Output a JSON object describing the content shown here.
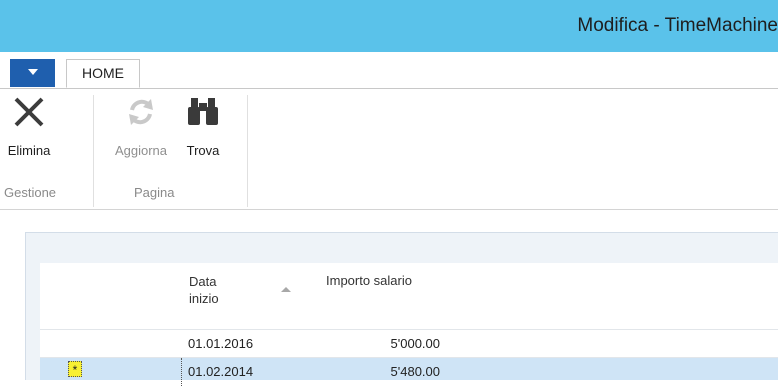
{
  "window": {
    "title": "Modifica - TimeMachine"
  },
  "ribbon": {
    "app_button_icon": "dropdown-triangle-icon",
    "tabs": [
      {
        "label": "HOME",
        "active": true
      }
    ],
    "groups": [
      {
        "label": "Gestione",
        "buttons": [
          {
            "label": "Elimina",
            "icon": "delete-x-icon",
            "enabled": true
          }
        ]
      },
      {
        "label": "Pagina",
        "buttons": [
          {
            "label": "Aggiorna",
            "icon": "refresh-icon",
            "enabled": false
          },
          {
            "label": "Trova",
            "icon": "binoculars-icon",
            "enabled": true
          }
        ]
      }
    ]
  },
  "grid": {
    "columns": [
      {
        "label": "Data\ninizio",
        "sorted": "ascending"
      },
      {
        "label": "Importo salario"
      }
    ],
    "rows": [
      {
        "marker": "",
        "data_inizio": "01.01.2016",
        "importo": "5'000.00",
        "selected": false
      },
      {
        "marker": "*",
        "data_inizio": "01.02.2014",
        "importo": "5'480.00",
        "selected": true
      }
    ]
  },
  "colors": {
    "titlebar": "#5ac2ea",
    "app_button": "#1f5fae",
    "selected_row": "#cfe4f6",
    "marker": "#f8f033"
  }
}
